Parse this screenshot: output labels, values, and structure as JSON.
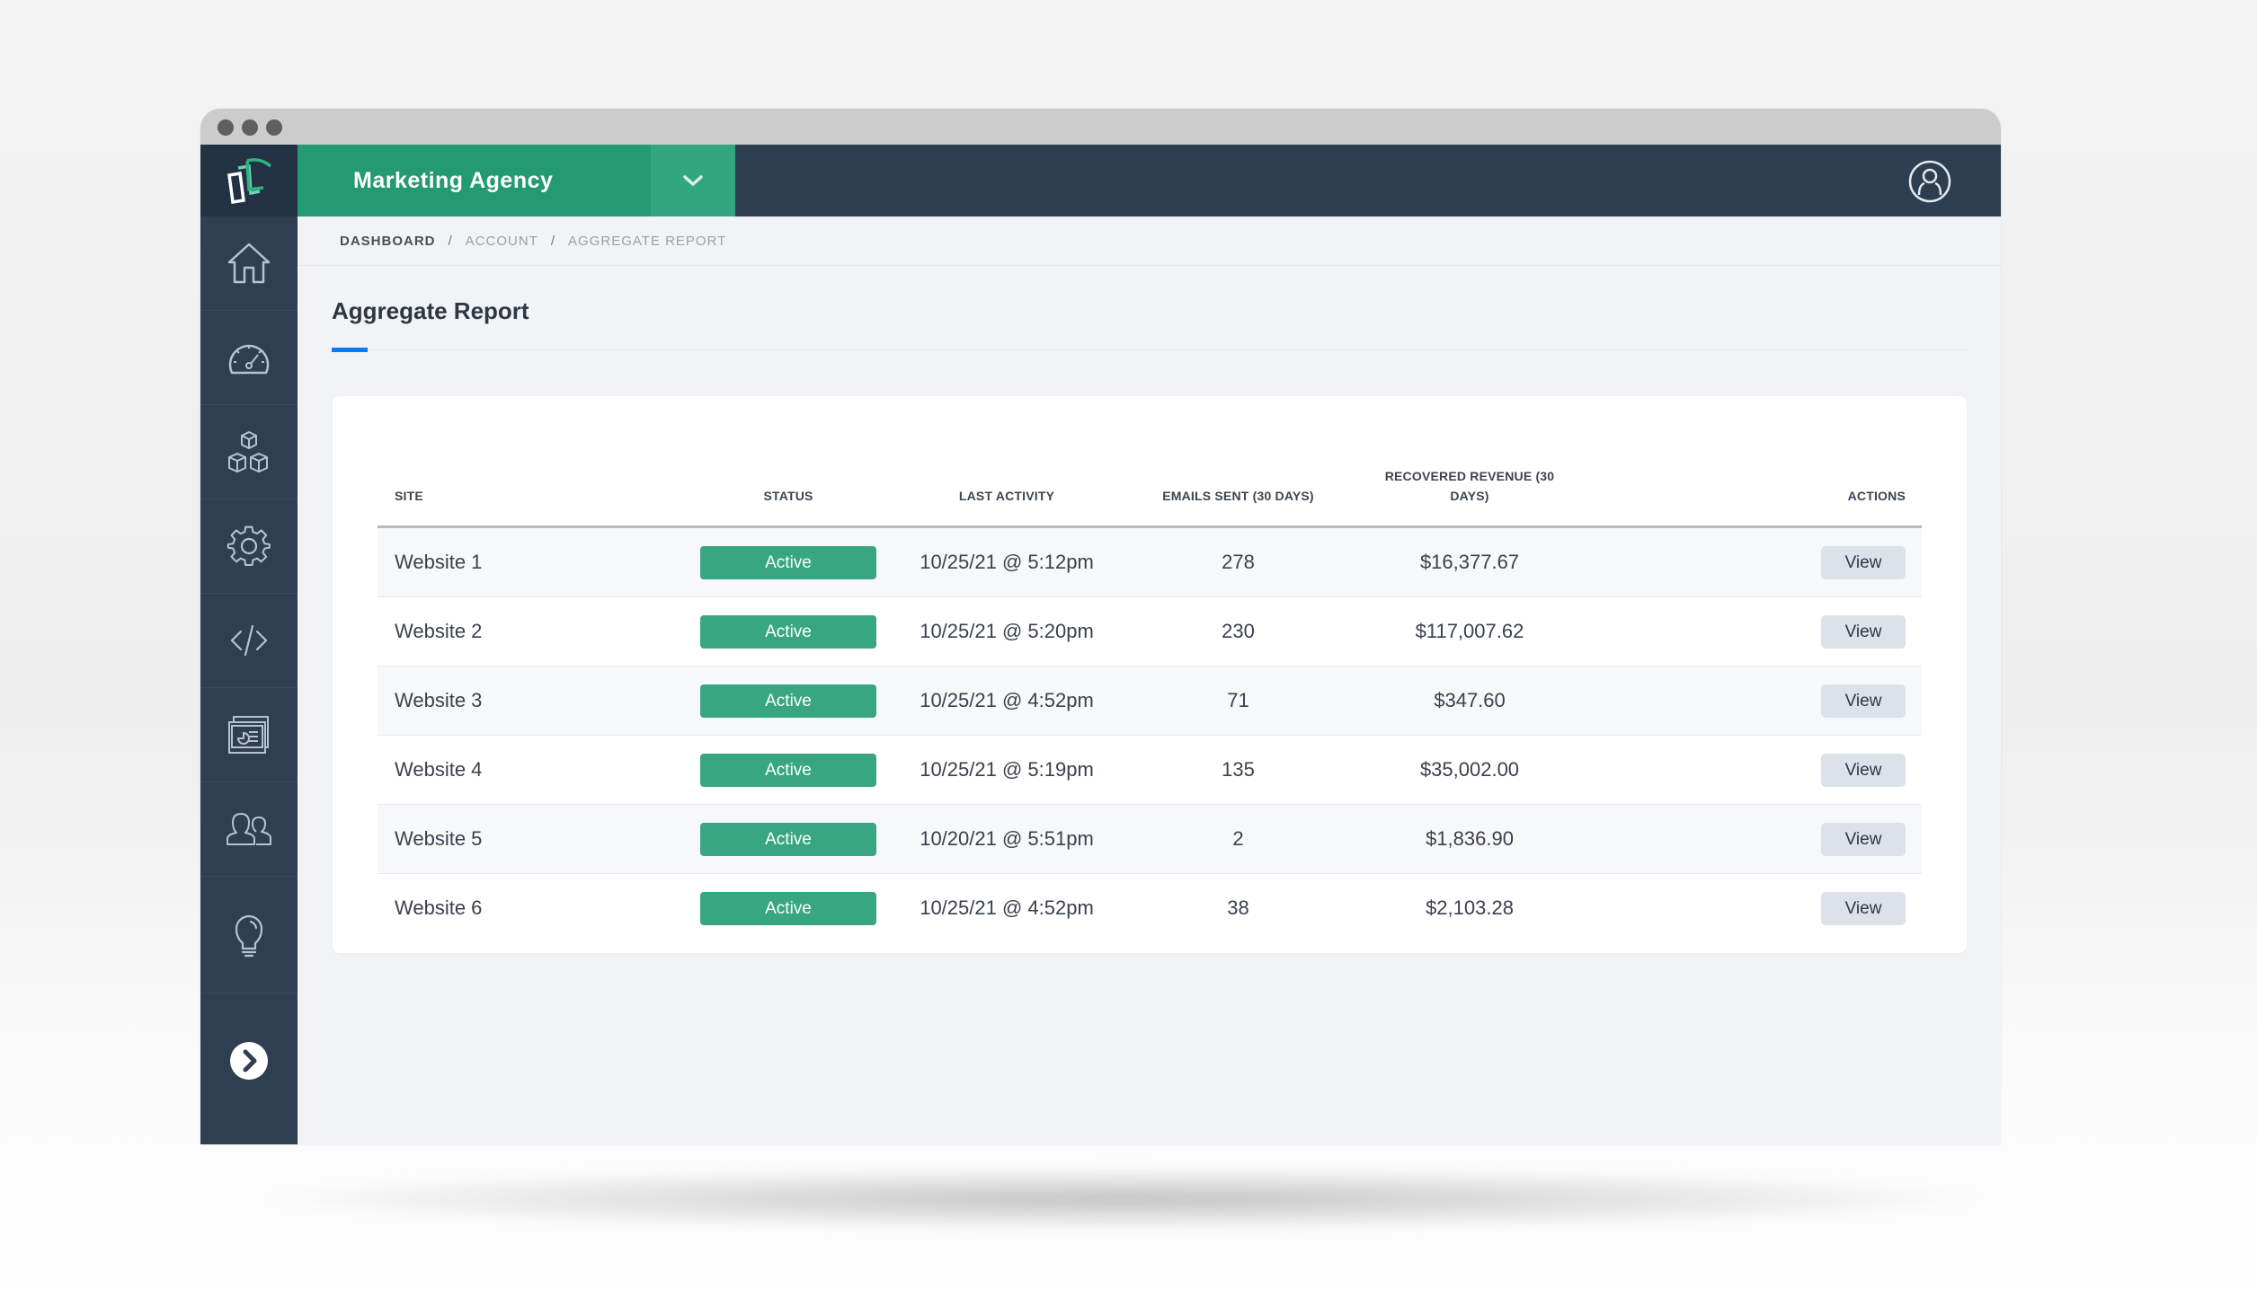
{
  "header": {
    "account_name": "Marketing Agency",
    "account_toggle_icon": "chevron-down-icon",
    "user_icon": "user-circle-icon",
    "logo_icon": "stacked-pages-logo-icon",
    "colors": {
      "brand_green": "#239a72",
      "header_dark": "#2c3e50",
      "accent_blue": "#0a7bf0"
    }
  },
  "sidebar": {
    "items": [
      {
        "name": "home",
        "icon": "home-icon"
      },
      {
        "name": "dashboard",
        "icon": "gauge-icon"
      },
      {
        "name": "integrations",
        "icon": "cubes-icon"
      },
      {
        "name": "settings",
        "icon": "gear-icon"
      },
      {
        "name": "code",
        "icon": "code-icon"
      },
      {
        "name": "reports",
        "icon": "report-cards-icon"
      },
      {
        "name": "users",
        "icon": "users-icon"
      },
      {
        "name": "ideas",
        "icon": "lightbulb-icon"
      }
    ],
    "expand_icon": "chevron-right-circle-icon"
  },
  "breadcrumb": {
    "items": [
      "DASHBOARD",
      "ACCOUNT",
      "AGGREGATE REPORT"
    ],
    "separator": "/"
  },
  "page": {
    "title": "Aggregate Report"
  },
  "table": {
    "columns": [
      "SITE",
      "STATUS",
      "LAST ACTIVITY",
      "EMAILS SENT (30 DAYS)",
      "RECOVERED REVENUE (30 DAYS)",
      "ACTIONS"
    ],
    "rows": [
      {
        "site": "Website 1",
        "status": "Active",
        "last_activity": "10/25/21 @ 5:12pm",
        "emails_sent": "278",
        "revenue": "$16,377.67",
        "action": "View"
      },
      {
        "site": "Website 2",
        "status": "Active",
        "last_activity": "10/25/21 @ 5:20pm",
        "emails_sent": "230",
        "revenue": "$117,007.62",
        "action": "View"
      },
      {
        "site": "Website 3",
        "status": "Active",
        "last_activity": "10/25/21 @ 4:52pm",
        "emails_sent": "71",
        "revenue": "$347.60",
        "action": "View"
      },
      {
        "site": "Website 4",
        "status": "Active",
        "last_activity": "10/25/21 @ 5:19pm",
        "emails_sent": "135",
        "revenue": "$35,002.00",
        "action": "View"
      },
      {
        "site": "Website 5",
        "status": "Active",
        "last_activity": "10/20/21 @ 5:51pm",
        "emails_sent": "2",
        "revenue": "$1,836.90",
        "action": "View"
      },
      {
        "site": "Website 6",
        "status": "Active",
        "last_activity": "10/25/21 @ 4:52pm",
        "emails_sent": "38",
        "revenue": "$2,103.28",
        "action": "View"
      }
    ]
  }
}
